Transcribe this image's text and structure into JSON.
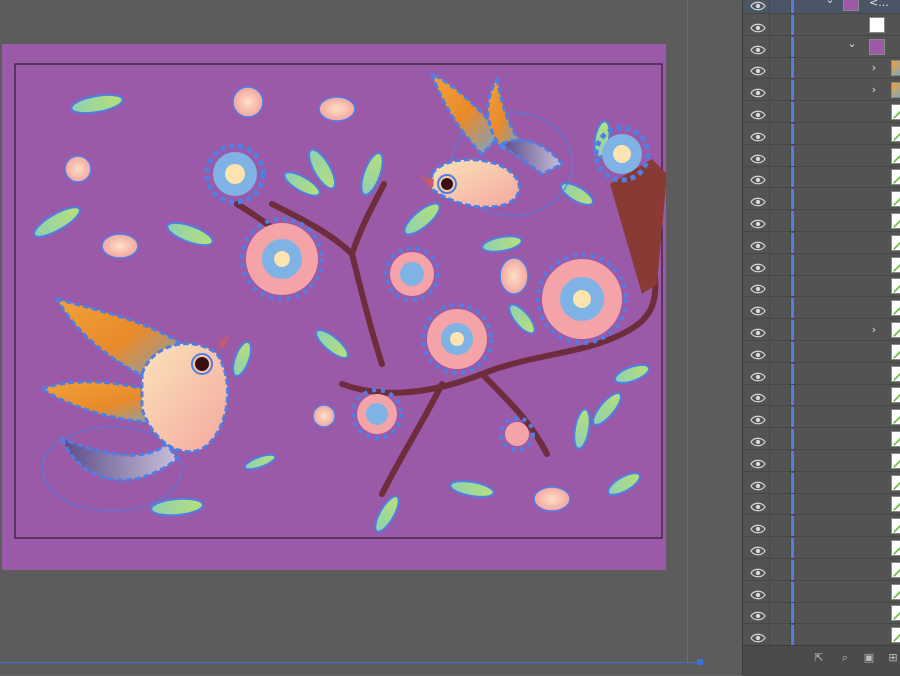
{
  "canvas": {
    "artboard_color": "#9b5aa7",
    "selection_color": "#4f7ee5"
  },
  "layers_panel": {
    "top_layer_name": "<...",
    "rows": [
      {
        "expand": "down",
        "thumb": "artwork",
        "selected": true
      },
      {
        "expand": "none",
        "thumb": "blank"
      },
      {
        "expand": "down",
        "thumb": "artwork"
      },
      {
        "expand": "right",
        "thumb": "bird"
      },
      {
        "expand": "right",
        "thumb": "bird"
      },
      {
        "expand": "none",
        "thumb": "leaf"
      },
      {
        "expand": "none",
        "thumb": "leaf"
      },
      {
        "expand": "none",
        "thumb": "leaf"
      },
      {
        "expand": "none",
        "thumb": "leaf"
      },
      {
        "expand": "none",
        "thumb": "leaf"
      },
      {
        "expand": "none",
        "thumb": "leaf"
      },
      {
        "expand": "none",
        "thumb": "leaf"
      },
      {
        "expand": "none",
        "thumb": "leaf"
      },
      {
        "expand": "none",
        "thumb": "leaf"
      },
      {
        "expand": "none",
        "thumb": "leaf"
      },
      {
        "expand": "right",
        "thumb": "leaf"
      },
      {
        "expand": "none",
        "thumb": "leaf"
      },
      {
        "expand": "none",
        "thumb": "leaf"
      },
      {
        "expand": "none",
        "thumb": "leaf"
      },
      {
        "expand": "none",
        "thumb": "leaf"
      },
      {
        "expand": "none",
        "thumb": "leaf"
      },
      {
        "expand": "none",
        "thumb": "leaf"
      },
      {
        "expand": "none",
        "thumb": "leaf"
      },
      {
        "expand": "none",
        "thumb": "leaf"
      },
      {
        "expand": "none",
        "thumb": "leaf"
      },
      {
        "expand": "none",
        "thumb": "leaf"
      },
      {
        "expand": "none",
        "thumb": "leaf"
      },
      {
        "expand": "none",
        "thumb": "leaf"
      },
      {
        "expand": "none",
        "thumb": "leaf"
      },
      {
        "expand": "none",
        "thumb": "leaf"
      }
    ],
    "footer_icons": [
      "collect-for-export-icon",
      "locate-object-icon",
      "make-clipping-mask-icon",
      "new-sublayer-icon"
    ]
  }
}
